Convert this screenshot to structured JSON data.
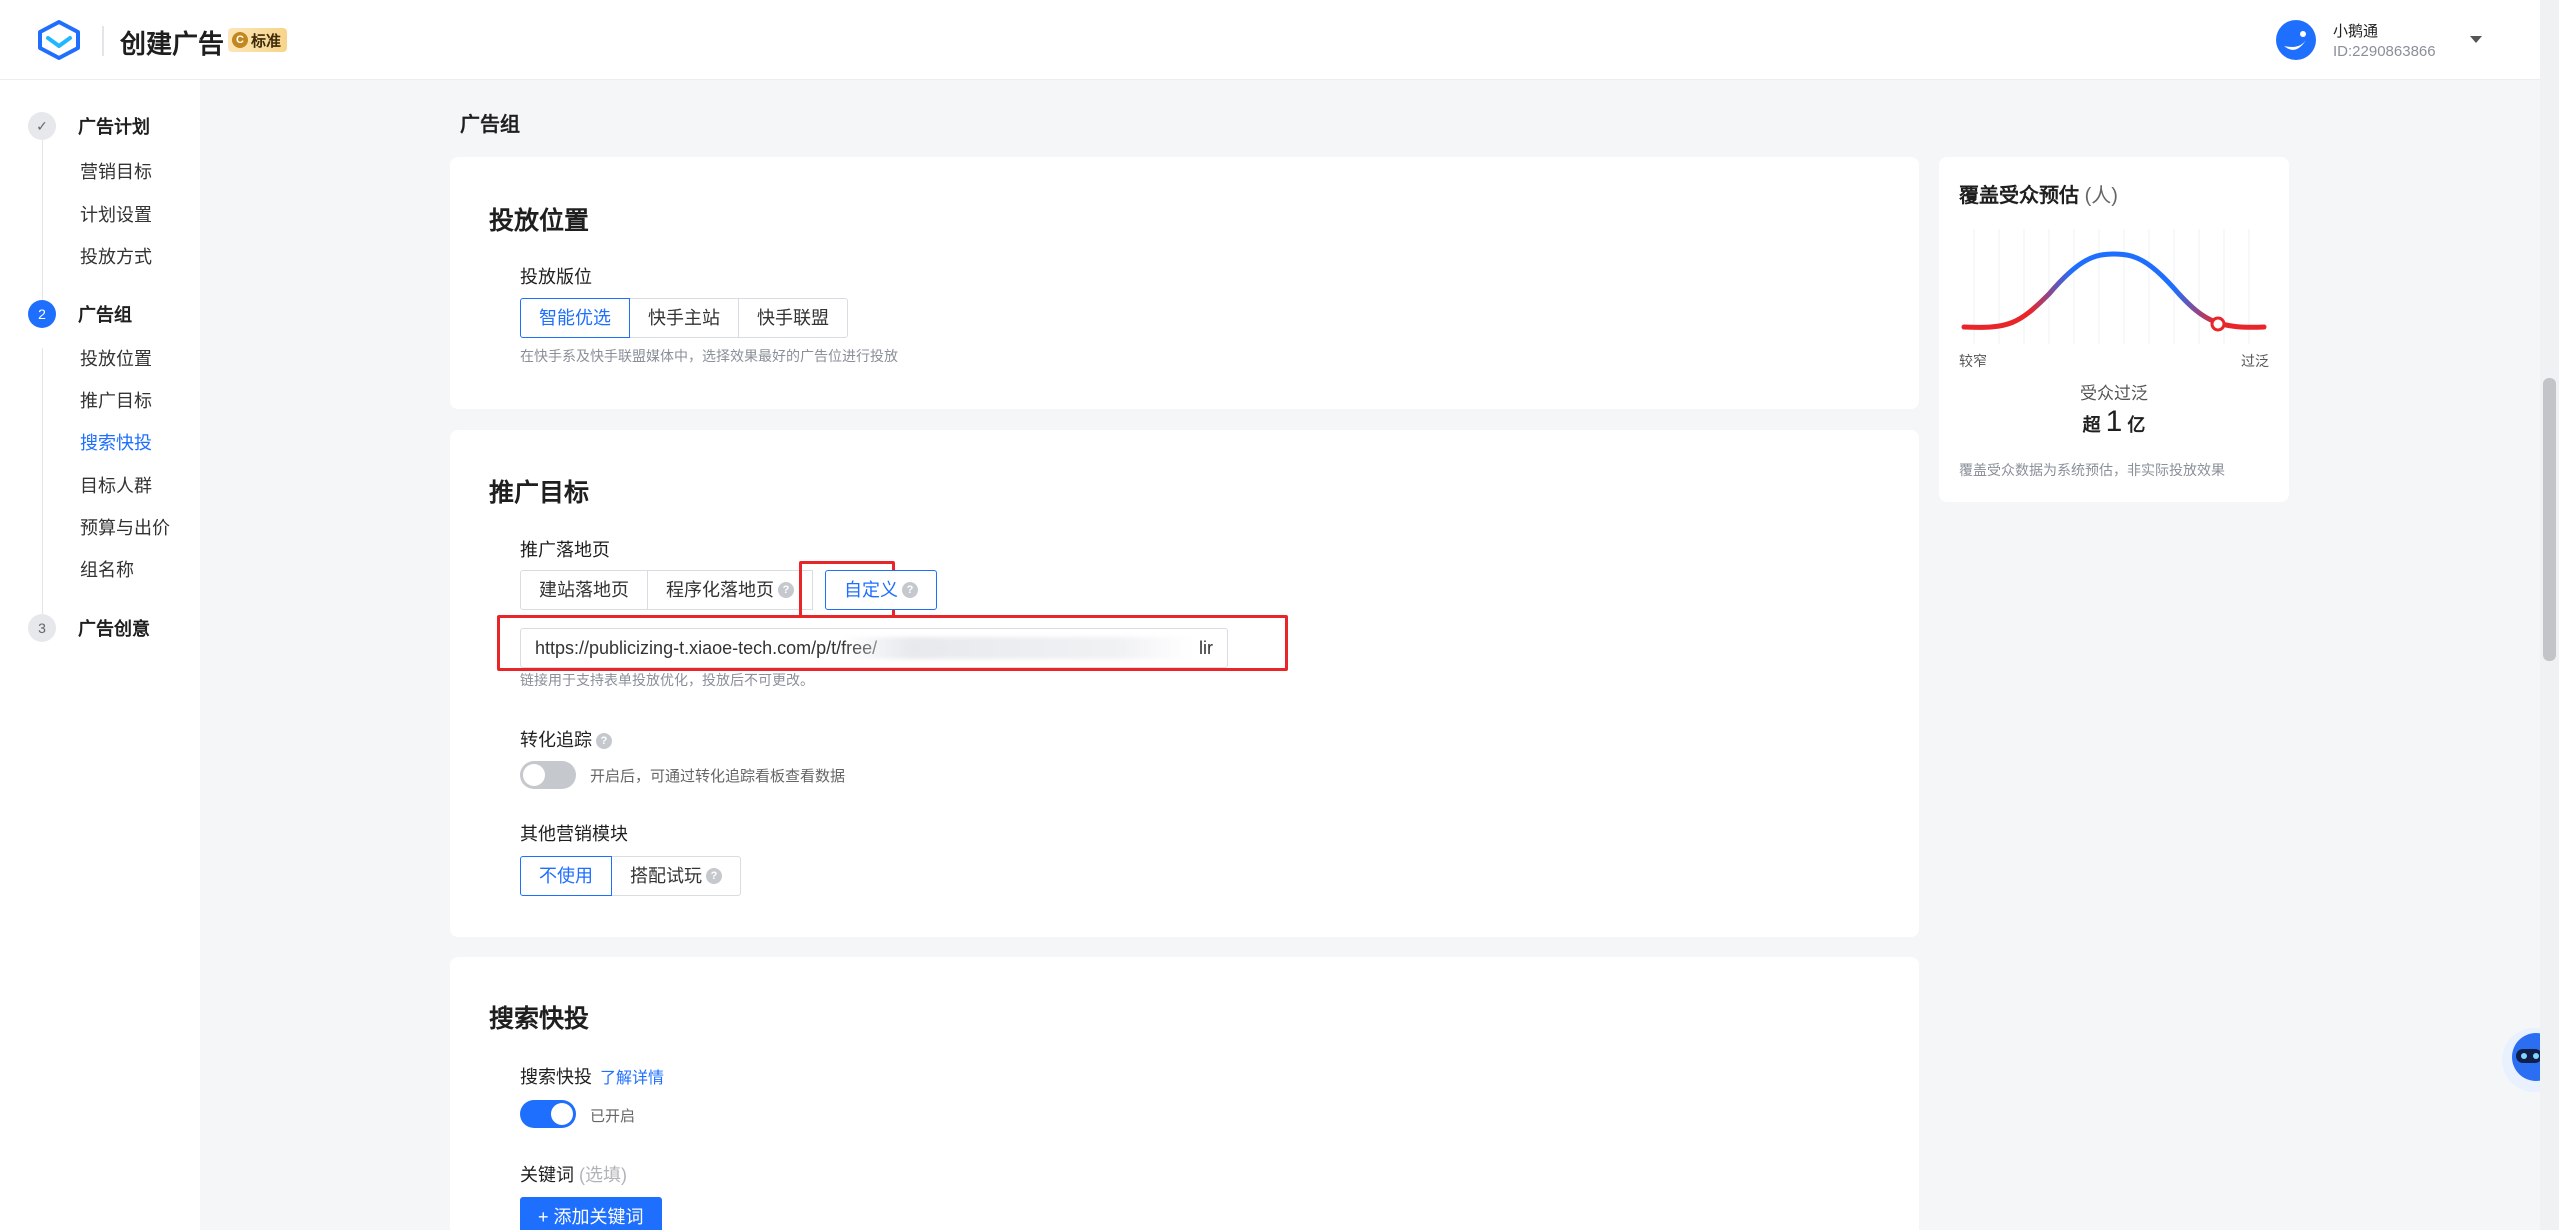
{
  "header": {
    "title": "创建广告",
    "badge_icon": "C",
    "badge_text": "标准",
    "user_name": "小鹅通",
    "user_id": "ID:2290863866"
  },
  "sidebar": {
    "steps": [
      {
        "number": "✓",
        "label": "广告计划",
        "subs": [
          "营销目标",
          "计划设置",
          "投放方式"
        ]
      },
      {
        "number": "2",
        "label": "广告组",
        "subs": [
          "投放位置",
          "推广目标",
          "搜索快投",
          "目标人群",
          "预算与出价",
          "组名称"
        ],
        "active_sub": "搜索快投"
      },
      {
        "number": "3",
        "label": "广告创意",
        "subs": []
      }
    ]
  },
  "main": {
    "section_label": "广告组",
    "placement": {
      "title": "投放位置",
      "field_label": "投放版位",
      "options": [
        "智能优选",
        "快手主站",
        "快手联盟"
      ],
      "selected": "智能优选",
      "hint": "在快手系及快手联盟媒体中，选择效果最好的广告位进行投放"
    },
    "promotion": {
      "title": "推广目标",
      "field_label": "推广落地页",
      "options": [
        "建站落地页",
        "程序化落地页",
        "自定义"
      ],
      "selected": "自定义",
      "url_value": "https://publicizing-t.xiaoe-tech.com/p/t/free/",
      "url_tail": "lir",
      "url_hint": "链接用于支持表单投放优化，投放后不可更改。",
      "tracking_label": "转化追踪",
      "tracking_state": "off",
      "tracking_hint": "开启后，可通过转化追踪看板查看数据",
      "other_label": "其他营销模块",
      "other_options": [
        "不使用",
        "搭配试玩"
      ],
      "other_selected": "不使用"
    },
    "search": {
      "title": "搜索快投",
      "field_label": "搜索快投",
      "detail_link": "了解详情",
      "toggle_state": "on",
      "toggle_text": "已开启",
      "keywords_label": "关键词",
      "keywords_optional": "(选填)",
      "add_button": "+ 添加关键词"
    }
  },
  "audience_panel": {
    "title": "覆盖受众预估",
    "unit": "(人)",
    "label_narrow": "较窄",
    "label_broad": "过泛",
    "status": "受众过泛",
    "count_prefix": "超",
    "count_number": "1",
    "count_unit": "亿",
    "note": "覆盖受众数据为系统预估，非实际投放效果",
    "colors": {
      "warn": "#e8262a",
      "ok": "#1f6fff"
    }
  }
}
